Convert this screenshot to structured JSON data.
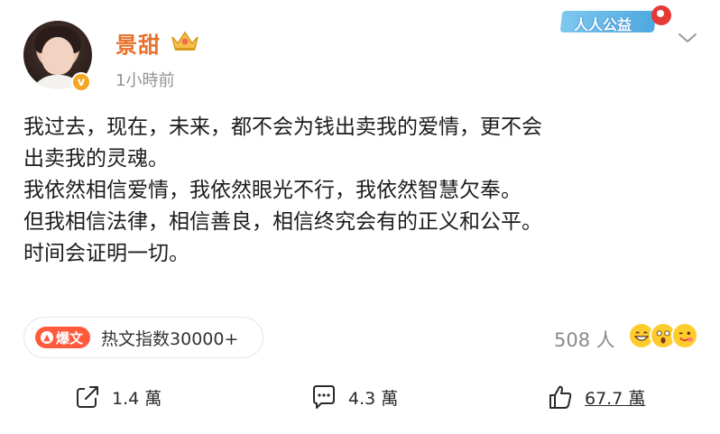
{
  "post": {
    "username": "景甜",
    "timestamp": "1小時前",
    "verified_mark": "v",
    "crown_icon": "crown-icon",
    "banner_label": "人人公益",
    "text_lines": [
      "我过去，现在，未来，都不会为钱出卖我的爱情，更不会",
      "出卖我的灵魂。",
      "我依然相信爱情，我依然眼光不行，我依然智慧欠奉。",
      "但我相信法律，相信善良，相信终究会有的正义和公平。",
      "时间会证明一切。"
    ]
  },
  "hot": {
    "tag_label": "爆文",
    "index_text": "热文指数30000+"
  },
  "reactions": {
    "count_text": "508 人"
  },
  "actions": {
    "share_count": "1.4 萬",
    "comment_count": "4.3 萬",
    "like_count": "67.7 萬"
  },
  "colors": {
    "username": "#e8702a",
    "hot_tag": "#ff5a3c",
    "verified": "#f5a623"
  }
}
